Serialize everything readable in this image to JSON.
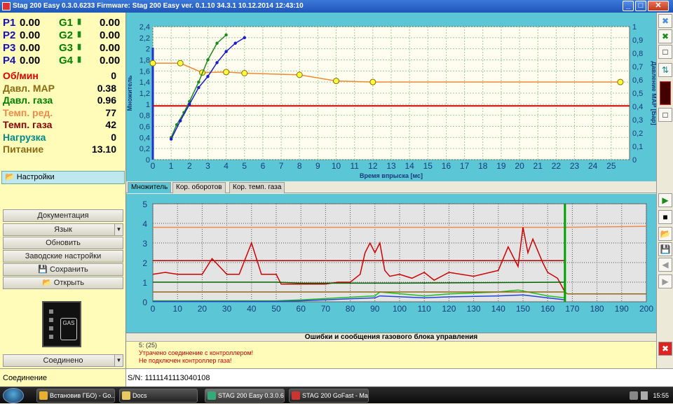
{
  "window": {
    "title": "Stag 200 Easy 0.3.0.6233 Firmware: Stag 200 Easy  ver. 0.1.10  34.3.1  10.12.2014 12:43:10"
  },
  "injectors": {
    "p": [
      {
        "label": "P1",
        "value": "0.00"
      },
      {
        "label": "P2",
        "value": "0.00"
      },
      {
        "label": "P3",
        "value": "0.00"
      },
      {
        "label": "P4",
        "value": "0.00"
      }
    ],
    "g": [
      {
        "label": "G1",
        "value": "0.00"
      },
      {
        "label": "G2",
        "value": "0.00"
      },
      {
        "label": "G3",
        "value": "0.00"
      },
      {
        "label": "G4",
        "value": "0.00"
      }
    ]
  },
  "params": [
    {
      "label": "Об/мин",
      "value": "0",
      "color": "#e00000"
    },
    {
      "label": "Давл. MAP",
      "value": "0.38",
      "color": "#8b6a14"
    },
    {
      "label": "Давл. газа",
      "value": "0.96",
      "color": "#008000"
    },
    {
      "label": "Темп. ред.",
      "value": "77",
      "color": "#f08a4b"
    },
    {
      "label": "Темп. газа",
      "value": "42",
      "color": "#8b0000"
    },
    {
      "label": "Нагрузка",
      "value": "0",
      "color": "#008b8b"
    },
    {
      "label": "Питание",
      "value": "13.10",
      "color": "#8b6a14"
    }
  ],
  "left": {
    "settings_label": "Настройки",
    "doc_label": "Документация",
    "lang_label": "Язык",
    "update_label": "Обновить",
    "factory_label": "Заводские настройки",
    "save_label": "Сохранить",
    "open_label": "Открыть",
    "connect_label": "Соединено",
    "device_label": "GAS"
  },
  "status": {
    "left": "Соединение",
    "sn": "S/N:  1111141113040108"
  },
  "tabs": [
    "Множитель",
    "Кор. оборотов",
    "Кор. темп. газа"
  ],
  "messages": {
    "header": "Ошибки и сообщения газового блока управления",
    "lines": [
      "5:  (25)",
      "Утрачено соединение с контроллером!",
      "Не подключен контроллер газа!"
    ]
  },
  "taskbar": {
    "items": [
      "Встановив ГБО) - Go...",
      "Docs",
      "STAG 200 Easy 0.3.0.6...",
      "STAG 200 GoFast - Ma..."
    ],
    "clock": "15:55"
  },
  "chart_data": [
    {
      "type": "line",
      "xlabel": "Время впрыска [мс]",
      "ylabel": "Множитель",
      "y2label": "Давление MAP [Бар]",
      "xlim": [
        0,
        26
      ],
      "xticks": [
        0,
        1,
        2,
        3,
        4,
        5,
        6,
        7,
        8,
        9,
        10,
        11,
        12,
        13,
        14,
        15,
        16,
        17,
        18,
        19,
        20,
        21,
        22,
        23,
        24,
        25
      ],
      "ylim": [
        0,
        2.4
      ],
      "yticks": [
        "0",
        "0,2",
        "0,4",
        "0,6",
        "0,8",
        "1",
        "1,2",
        "1,4",
        "1,6",
        "1,8",
        "2",
        "2,2",
        "2,4"
      ],
      "y2lim": [
        0,
        1
      ],
      "y2ticks": [
        "0",
        "0,1",
        "0,2",
        "0,3",
        "0,4",
        "0,5",
        "0,6",
        "0,7",
        "0,8",
        "0,9",
        "1"
      ],
      "grid": true,
      "series": [
        {
          "color": "#f08a30",
          "axis": "y",
          "x": [
            0,
            1.5,
            2.7,
            4,
            5,
            8,
            10,
            12,
            25.5
          ],
          "y": [
            1.74,
            1.74,
            1.57,
            1.58,
            1.56,
            1.53,
            1.42,
            1.4,
            1.4
          ]
        },
        {
          "color": "#d00000",
          "axis": "y",
          "x": [
            0,
            26
          ],
          "y": [
            0.97,
            0.97
          ]
        },
        {
          "color": "#1a8a1a",
          "axis": "y",
          "x": [
            1,
            1.3,
            1.7,
            2,
            2.5,
            3,
            3.5,
            4
          ],
          "y": [
            0.4,
            0.63,
            0.85,
            1.05,
            1.4,
            1.8,
            2.1,
            2.25
          ]
        },
        {
          "color": "#1a1ad0",
          "axis": "y",
          "x": [
            1,
            1.5,
            2,
            2.5,
            3,
            3.5,
            4,
            4.5,
            5
          ],
          "y": [
            0.37,
            0.7,
            1.0,
            1.3,
            1.5,
            1.75,
            1.95,
            2.1,
            2.2
          ]
        }
      ]
    },
    {
      "type": "line",
      "xlim": [
        0,
        200
      ],
      "xticks": [
        0,
        10,
        20,
        30,
        40,
        50,
        60,
        70,
        80,
        90,
        100,
        110,
        120,
        130,
        140,
        150,
        160,
        170,
        180,
        190,
        200
      ],
      "ylim": [
        0,
        5
      ],
      "yticks": [
        0,
        1,
        2,
        3,
        4,
        5
      ],
      "grid": true,
      "series": [
        {
          "color": "#f08a4b",
          "x": [
            0,
            167,
            200
          ],
          "y": [
            3.8,
            3.8,
            3.85
          ]
        },
        {
          "color": "#b00000",
          "x": [
            0,
            167
          ],
          "y": [
            2.1,
            2.1
          ]
        },
        {
          "color": "#d00000",
          "x": [
            0,
            5,
            10,
            20,
            24,
            30,
            35,
            40,
            44,
            50,
            52,
            60,
            65,
            70,
            75,
            80,
            84,
            86,
            88,
            90,
            92,
            94,
            96,
            100,
            105,
            110,
            114,
            120,
            130,
            140,
            144,
            148,
            150,
            152,
            154,
            158,
            160,
            164,
            167
          ],
          "y": [
            1.4,
            1.5,
            1.4,
            1.4,
            2.2,
            1.4,
            1.4,
            3.0,
            1.4,
            1.4,
            0.9,
            0.9,
            0.9,
            0.9,
            1.0,
            1.0,
            1.4,
            2.5,
            3.0,
            2.5,
            3.0,
            1.6,
            1.3,
            1.4,
            1.2,
            1.5,
            1.1,
            1.5,
            1.3,
            1.6,
            2.8,
            1.8,
            3.8,
            2.5,
            3.2,
            2.0,
            1.5,
            1.2,
            0.5
          ]
        },
        {
          "color": "#006400",
          "x": [
            0,
            50,
            60,
            100,
            167
          ],
          "y": [
            1.0,
            1.0,
            0.95,
            0.95,
            1.0
          ]
        },
        {
          "color": "#1fbf1f",
          "x": [
            0,
            50,
            60,
            90,
            92,
            110,
            120,
            140,
            148,
            160,
            167
          ],
          "y": [
            0.05,
            0.05,
            0.1,
            0.3,
            0.5,
            0.3,
            0.4,
            0.5,
            0.6,
            0.3,
            0.2
          ]
        },
        {
          "color": "#2244dd",
          "x": [
            0,
            50,
            60,
            90,
            92,
            110,
            120,
            140,
            150,
            160,
            167
          ],
          "y": [
            0.02,
            0.02,
            0.05,
            0.2,
            0.3,
            0.2,
            0.25,
            0.3,
            0.35,
            0.2,
            0.1
          ]
        },
        {
          "color": "#8b6a14",
          "x": [
            0,
            167,
            168,
            200
          ],
          "y": [
            0.5,
            0.5,
            0.4,
            0.4
          ]
        },
        {
          "color": "#00a000",
          "x": [
            167,
            167
          ],
          "y": [
            0,
            5
          ]
        }
      ]
    }
  ]
}
